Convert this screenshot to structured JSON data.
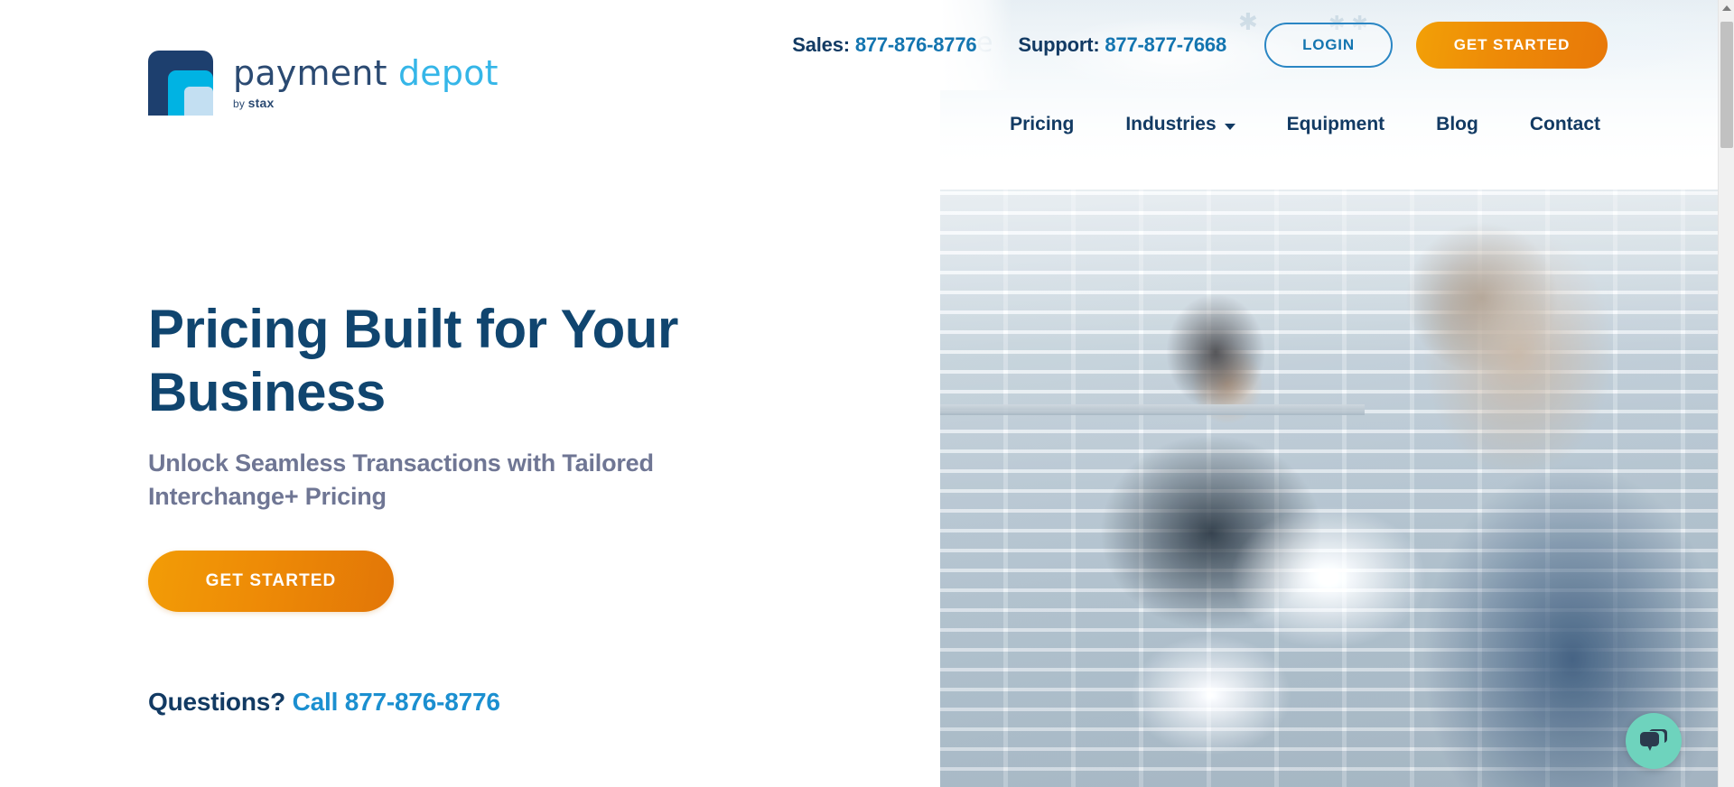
{
  "brand": {
    "word_primary": "payment",
    "word_secondary": "depot",
    "sub_by": "by ",
    "sub_name": "stax",
    "colors": {
      "navy": "#1d3f6e",
      "cyan": "#00b3e3",
      "pale": "#c3dff2"
    }
  },
  "topbar": {
    "sales_label": "Sales:",
    "sales_number": "877-876-8776",
    "support_label": "Support:",
    "support_number": "877-877-7668",
    "login_label": "LOGIN",
    "get_started_label": "GET STARTED",
    "login_color": "#1475b0",
    "cta_color": "#ee8c07"
  },
  "nav": {
    "items": [
      {
        "label": "Pricing",
        "has_dropdown": false
      },
      {
        "label": "Industries",
        "has_dropdown": true
      },
      {
        "label": "Equipment",
        "has_dropdown": false
      },
      {
        "label": "Blog",
        "has_dropdown": false
      },
      {
        "label": "Contact",
        "has_dropdown": false
      }
    ]
  },
  "hero": {
    "title": "Pricing Built for Your Business",
    "subtitle": "Unlock Seamless Transactions with Tailored Interchange+ Pricing",
    "cta_label": "GET STARTED",
    "questions_label": "Questions?",
    "questions_call": "Call 877-876-8776",
    "title_color": "#10456f",
    "subtitle_color": "#6f7694"
  },
  "chat": {
    "icon": "chat-bubble-icon",
    "bubble_color": "#6ed3bd"
  },
  "scrollbar": {
    "up_arrow_icon": "chevron-up-icon"
  }
}
